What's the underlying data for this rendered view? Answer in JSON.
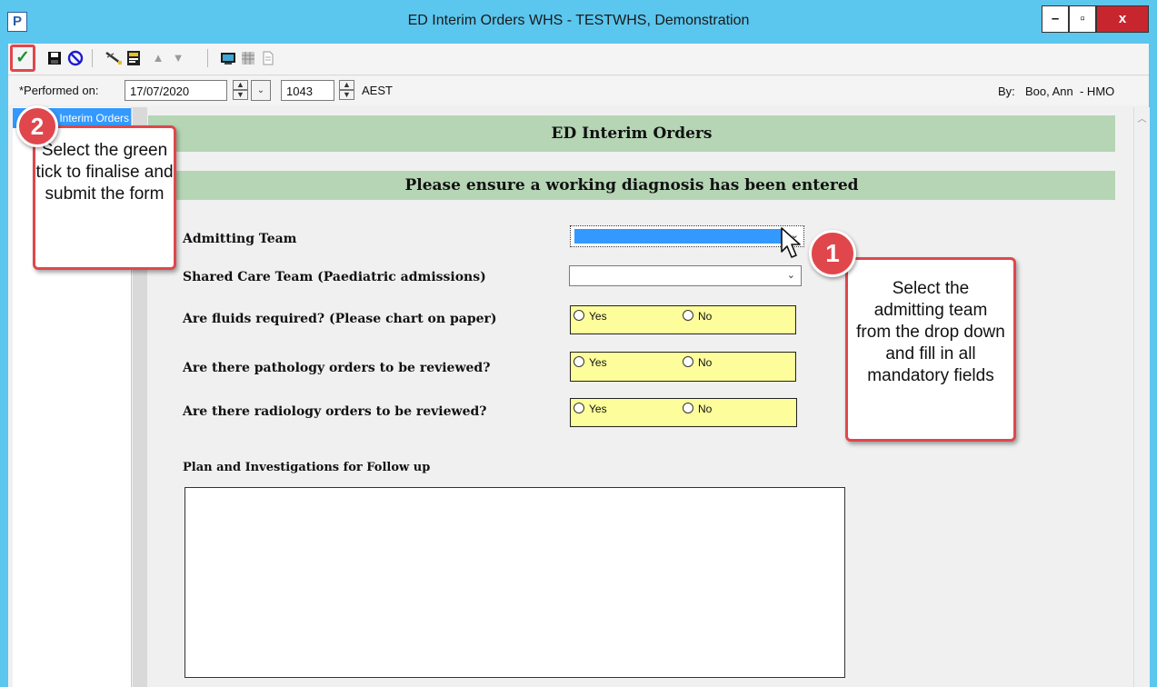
{
  "window": {
    "app_icon": "P",
    "title": "ED Interim Orders WHS - TESTWHS, Demonstration",
    "minimize": "–",
    "maximize": "▫",
    "close": "x"
  },
  "toolbar": {
    "icons": [
      "green-tick-icon",
      "save-icon",
      "cancel-icon",
      "pen-icon",
      "form-icon",
      "arrow-up-icon",
      "arrow-down-icon",
      "monitor-icon",
      "grid-icon",
      "document-icon"
    ],
    "tick_color": "#1e8f3c"
  },
  "performed": {
    "label": "*Performed on:",
    "date": "17/07/2020",
    "time": "1043",
    "timezone": "AEST",
    "by_label": "By:",
    "by_value": "Boo, Ann  - HMO"
  },
  "nav": {
    "selected_item": "Interim Orders"
  },
  "form": {
    "banner_title": "ED Interim Orders",
    "banner_warning": "Please ensure a working diagnosis has been entered",
    "admitting_team_label": "Admitting Team",
    "shared_care_label": "Shared Care Team (Paediatric admissions)",
    "questions": [
      {
        "label": "Are fluids required? (Please chart on paper)",
        "yes": "Yes",
        "no": "No"
      },
      {
        "label": "Are there pathology orders to be reviewed?",
        "yes": "Yes",
        "no": "No"
      },
      {
        "label": "Are there radiology orders to be reviewed?",
        "yes": "Yes",
        "no": "No"
      }
    ],
    "plan_label": "Plan and Investigations for Follow up",
    "plan_value": ""
  },
  "callouts": {
    "one": {
      "number": "1",
      "text": "Select the admitting team from the drop down and fill in all mandatory fields"
    },
    "two": {
      "number": "2",
      "text": "Select the green tick to finalise and submit the form"
    }
  },
  "colors": {
    "window_frame": "#5bc6ee",
    "banner_green": "#b5d5b5",
    "mandatory_yellow": "#fdfd9b",
    "callout_red": "#e0474c",
    "selection_blue": "#3399ff"
  }
}
